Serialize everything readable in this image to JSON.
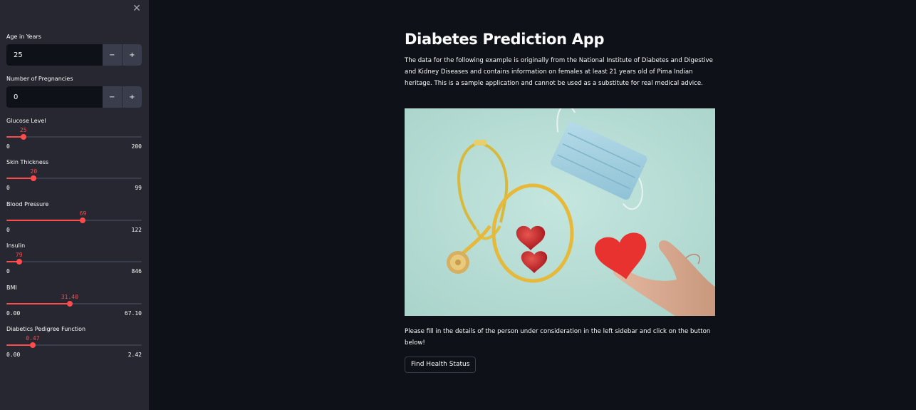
{
  "sidebar": {
    "close_glyph": "✕",
    "age": {
      "label": "Age in Years",
      "value": "25",
      "minus": "−",
      "plus": "+"
    },
    "pregnancies": {
      "label": "Number of Pregnancies",
      "value": "0",
      "minus": "−",
      "plus": "+"
    },
    "sliders": [
      {
        "label": "Glucose Level",
        "value": "25",
        "value_num": 25,
        "min": "0",
        "max": "200",
        "min_num": 0,
        "max_num": 200
      },
      {
        "label": "Skin Thickness",
        "value": "20",
        "value_num": 20,
        "min": "0",
        "max": "99",
        "min_num": 0,
        "max_num": 99
      },
      {
        "label": "Blood Pressure",
        "value": "69",
        "value_num": 69,
        "min": "0",
        "max": "122",
        "min_num": 0,
        "max_num": 122
      },
      {
        "label": "Insulin",
        "value": "79",
        "value_num": 79,
        "min": "0",
        "max": "846",
        "min_num": 0,
        "max_num": 846
      },
      {
        "label": "BMI",
        "value": "31.40",
        "value_num": 31.4,
        "min": "0.00",
        "max": "67.10",
        "min_num": 0,
        "max_num": 67.1
      },
      {
        "label": "Diabetics Pedigree Function",
        "value": "0.47",
        "value_num": 0.47,
        "min": "0.00",
        "max": "2.42",
        "min_num": 0,
        "max_num": 2.42
      }
    ]
  },
  "main": {
    "title": "Diabetes Prediction App",
    "description": "The data for the following example is originally from the National Institute of Diabetes and Digestive and Kidney Diseases and contains information on females at least 21 years old of Pima Indian heritage. This is a sample application and cannot be used as a substitute for real medical advice.",
    "instructions": "Please fill in the details of the person under consideration in the left sidebar and click on the button below!",
    "button_label": "Find Health Status"
  },
  "colors": {
    "accent": "#ff4b4b",
    "background": "#0e1117",
    "sidebar": "#262730"
  }
}
